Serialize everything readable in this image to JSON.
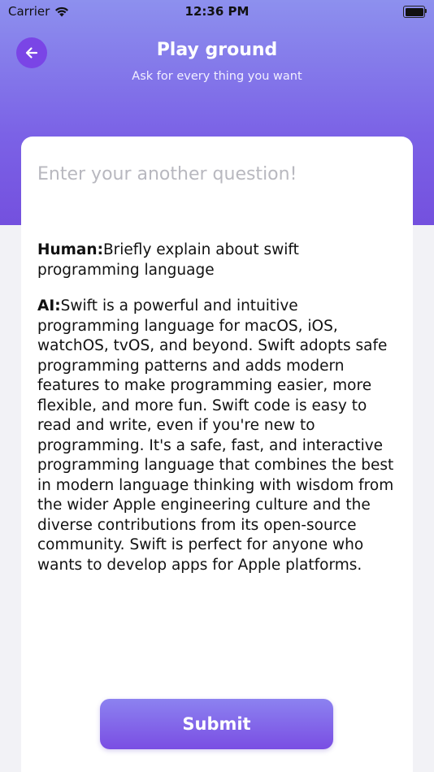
{
  "status_bar": {
    "carrier": "Carrier",
    "time": "12:36 PM",
    "wifi_icon": "wifi-icon",
    "battery_icon": "battery-icon"
  },
  "header": {
    "back_icon": "arrow-left-icon",
    "title": "Play ground",
    "subtitle": "Ask for every thing you want"
  },
  "input": {
    "value": "",
    "placeholder": "Enter your another question!"
  },
  "conversation": [
    {
      "speaker": "Human:",
      "text": "Briefly explain about swift programming language"
    },
    {
      "speaker": "AI:",
      "text": "Swift is a powerful and intuitive programming language for macOS, iOS, watchOS, tvOS, and beyond. Swift adopts safe programming patterns and adds modern features to make programming easier, more flexible, and more fun. Swift code is easy to read and write, even if you're new to programming. It's a safe, fast, and interactive programming language that combines the best in modern language thinking with wisdom from the wider Apple engineering culture and the diverse contributions from its open-source community. Swift is perfect for anyone who wants to develop apps for Apple platforms."
    }
  ],
  "submit_label": "Submit",
  "colors": {
    "header_gradient_top": "#8d90ee",
    "header_gradient_bottom": "#7450de",
    "accent": "#7a45e6",
    "card": "#ffffff",
    "background": "#f2f2f6",
    "placeholder": "#b8b8bf"
  }
}
